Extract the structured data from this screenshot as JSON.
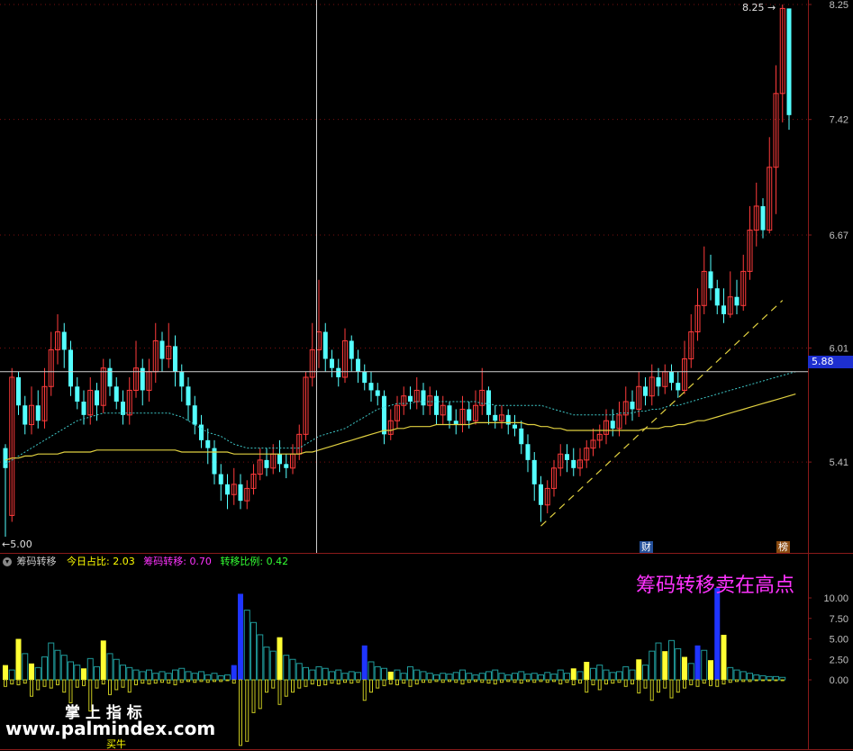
{
  "colors": {
    "up": "#ff3b3b",
    "down": "#54ffff",
    "ma_short": "#3ec8c8",
    "ma_long": "#e0d040",
    "grid": "#7a1010",
    "axis_text": "#c0c0c0",
    "today_ratio": "#ffff00",
    "chip_transfer": "#ff33ff",
    "transfer_ratio": "#33ff33",
    "bar_teal": "#1f9a9a",
    "bar_yellow": "#ffff33",
    "bar_blue": "#1f35ff",
    "neg_bar": "#c8c820",
    "annotation": "#ff33ff"
  },
  "price_panel": {
    "y_ticks": [
      "8.25",
      "7.42",
      "6.67",
      "6.01",
      "5.41"
    ],
    "y_tick_values": [
      8.25,
      7.42,
      6.67,
      6.01,
      5.41
    ],
    "current_price_label": "5.88",
    "current_price_value": 5.88,
    "high_label": "8.25",
    "high_value": 8.25,
    "low_label": "5.00",
    "low_value": 5.0,
    "badges": [
      "财",
      "榜"
    ]
  },
  "indicator_panel": {
    "name": "筹码转移",
    "today_ratio_label": "今日占比:",
    "today_ratio_value": "2.03",
    "chip_transfer_label": "筹码转移:",
    "chip_transfer_value": "0.70",
    "transfer_ratio_label": "转移比例:",
    "transfer_ratio_value": "0.42",
    "y_ticks": [
      "10.00",
      "7.50",
      "5.00",
      "2.50",
      "0.00"
    ],
    "y_tick_values": [
      10.0,
      7.5,
      5.0,
      2.5,
      0.0
    ],
    "annotation": "筹码转移卖在高点",
    "watermark_title": "掌 上 指 标",
    "watermark_url": "www.palmindex.com",
    "bottom_label": "买牛"
  },
  "chart_data": {
    "type": "candlestick",
    "y_scale": "log",
    "candles": [
      [
        5.48,
        5.38,
        5.5,
        5.05
      ],
      [
        5.15,
        5.85,
        5.9,
        5.12
      ],
      [
        5.85,
        5.7,
        5.88,
        5.65
      ],
      [
        5.7,
        5.6,
        5.75,
        5.55
      ],
      [
        5.6,
        5.7,
        5.8,
        5.55
      ],
      [
        5.7,
        5.62,
        5.78,
        5.58
      ],
      [
        5.62,
        5.8,
        5.9,
        5.58
      ],
      [
        5.8,
        6.0,
        6.1,
        5.75
      ],
      [
        6.0,
        6.1,
        6.2,
        5.92
      ],
      [
        6.1,
        6.0,
        6.15,
        5.9
      ],
      [
        6.0,
        5.8,
        6.05,
        5.75
      ],
      [
        5.8,
        5.72,
        5.85,
        5.68
      ],
      [
        5.72,
        5.65,
        5.78,
        5.6
      ],
      [
        5.65,
        5.78,
        5.85,
        5.6
      ],
      [
        5.78,
        5.7,
        5.82,
        5.62
      ],
      [
        5.7,
        5.9,
        5.95,
        5.66
      ],
      [
        5.9,
        5.8,
        5.95,
        5.75
      ],
      [
        5.8,
        5.72,
        5.85,
        5.68
      ],
      [
        5.72,
        5.65,
        5.78,
        5.6
      ],
      [
        5.65,
        5.78,
        5.85,
        5.6
      ],
      [
        5.78,
        5.9,
        6.05,
        5.74
      ],
      [
        5.9,
        5.78,
        5.95,
        5.7
      ],
      [
        5.78,
        5.88,
        5.95,
        5.72
      ],
      [
        5.88,
        6.05,
        6.15,
        5.82
      ],
      [
        6.05,
        5.95,
        6.1,
        5.88
      ],
      [
        5.95,
        6.02,
        6.15,
        5.9
      ],
      [
        6.02,
        5.88,
        6.08,
        5.8
      ],
      [
        5.88,
        5.8,
        5.92,
        5.72
      ],
      [
        5.8,
        5.7,
        5.85,
        5.62
      ],
      [
        5.7,
        5.6,
        5.75,
        5.55
      ],
      [
        5.6,
        5.52,
        5.65,
        5.48
      ],
      [
        5.52,
        5.48,
        5.58,
        5.4
      ],
      [
        5.48,
        5.35,
        5.52,
        5.3
      ],
      [
        5.35,
        5.3,
        5.4,
        5.22
      ],
      [
        5.3,
        5.25,
        5.35,
        5.18
      ],
      [
        5.25,
        5.3,
        5.38,
        5.2
      ],
      [
        5.3,
        5.22,
        5.35,
        5.18
      ],
      [
        5.22,
        5.28,
        5.32,
        5.18
      ],
      [
        5.28,
        5.35,
        5.4,
        5.25
      ],
      [
        5.35,
        5.42,
        5.48,
        5.32
      ],
      [
        5.42,
        5.38,
        5.48,
        5.34
      ],
      [
        5.38,
        5.45,
        5.5,
        5.35
      ],
      [
        5.45,
        5.4,
        5.52,
        5.36
      ],
      [
        5.4,
        5.38,
        5.45,
        5.33
      ],
      [
        5.38,
        5.45,
        5.5,
        5.35
      ],
      [
        5.45,
        5.55,
        5.6,
        5.42
      ],
      [
        5.55,
        5.85,
        5.88,
        5.52
      ],
      [
        5.85,
        6.0,
        6.15,
        5.8
      ],
      [
        6.0,
        6.1,
        6.4,
        5.9
      ],
      [
        6.1,
        5.95,
        6.15,
        5.88
      ],
      [
        5.95,
        5.9,
        6.0,
        5.85
      ],
      [
        5.9,
        5.85,
        5.95,
        5.8
      ],
      [
        5.85,
        6.05,
        6.12,
        5.82
      ],
      [
        6.05,
        5.95,
        6.08,
        5.88
      ],
      [
        5.95,
        5.88,
        6.0,
        5.82
      ],
      [
        5.88,
        5.82,
        5.92,
        5.78
      ],
      [
        5.82,
        5.78,
        5.88,
        5.72
      ],
      [
        5.78,
        5.75,
        5.82,
        5.7
      ],
      [
        5.75,
        5.55,
        5.78,
        5.5
      ],
      [
        5.55,
        5.62,
        5.68,
        5.52
      ],
      [
        5.62,
        5.7,
        5.75,
        5.58
      ],
      [
        5.7,
        5.75,
        5.8,
        5.65
      ],
      [
        5.75,
        5.72,
        5.8,
        5.68
      ],
      [
        5.72,
        5.78,
        5.85,
        5.68
      ],
      [
        5.78,
        5.7,
        5.82,
        5.65
      ],
      [
        5.7,
        5.75,
        5.8,
        5.65
      ],
      [
        5.75,
        5.65,
        5.78,
        5.6
      ],
      [
        5.65,
        5.7,
        5.75,
        5.6
      ],
      [
        5.7,
        5.62,
        5.72,
        5.58
      ],
      [
        5.62,
        5.6,
        5.68,
        5.55
      ],
      [
        5.6,
        5.68,
        5.75,
        5.56
      ],
      [
        5.68,
        5.62,
        5.72,
        5.58
      ],
      [
        5.62,
        5.7,
        5.78,
        5.6
      ],
      [
        5.7,
        5.78,
        5.9,
        5.65
      ],
      [
        5.78,
        5.65,
        5.8,
        5.6
      ],
      [
        5.65,
        5.62,
        5.7,
        5.58
      ],
      [
        5.62,
        5.65,
        5.7,
        5.58
      ],
      [
        5.65,
        5.6,
        5.68,
        5.55
      ],
      [
        5.6,
        5.58,
        5.65,
        5.54
      ],
      [
        5.58,
        5.5,
        5.62,
        5.45
      ],
      [
        5.5,
        5.42,
        5.55,
        5.36
      ],
      [
        5.42,
        5.3,
        5.46,
        5.22
      ],
      [
        5.3,
        5.2,
        5.34,
        5.12
      ],
      [
        5.2,
        5.28,
        5.32,
        5.16
      ],
      [
        5.28,
        5.38,
        5.42,
        5.24
      ],
      [
        5.38,
        5.45,
        5.5,
        5.34
      ],
      [
        5.45,
        5.42,
        5.5,
        5.36
      ],
      [
        5.42,
        5.38,
        5.48,
        5.34
      ],
      [
        5.38,
        5.42,
        5.48,
        5.34
      ],
      [
        5.42,
        5.48,
        5.52,
        5.38
      ],
      [
        5.48,
        5.52,
        5.58,
        5.44
      ],
      [
        5.52,
        5.55,
        5.6,
        5.48
      ],
      [
        5.55,
        5.62,
        5.68,
        5.5
      ],
      [
        5.62,
        5.58,
        5.68,
        5.54
      ],
      [
        5.58,
        5.65,
        5.72,
        5.54
      ],
      [
        5.65,
        5.72,
        5.8,
        5.6
      ],
      [
        5.72,
        5.68,
        5.78,
        5.62
      ],
      [
        5.68,
        5.8,
        5.88,
        5.64
      ],
      [
        5.8,
        5.75,
        5.85,
        5.7
      ],
      [
        5.75,
        5.85,
        5.92,
        5.7
      ],
      [
        5.85,
        5.8,
        5.9,
        5.75
      ],
      [
        5.8,
        5.88,
        5.92,
        5.76
      ],
      [
        5.88,
        5.82,
        5.92,
        5.78
      ],
      [
        5.82,
        5.78,
        5.88,
        5.74
      ],
      [
        5.78,
        5.95,
        6.05,
        5.76
      ],
      [
        5.95,
        6.1,
        6.2,
        5.9
      ],
      [
        6.1,
        6.25,
        6.35,
        6.05
      ],
      [
        6.25,
        6.45,
        6.6,
        6.2
      ],
      [
        6.45,
        6.35,
        6.55,
        6.28
      ],
      [
        6.35,
        6.25,
        6.4,
        6.2
      ],
      [
        6.25,
        6.2,
        6.35,
        6.15
      ],
      [
        6.2,
        6.3,
        6.45,
        6.18
      ],
      [
        6.3,
        6.25,
        6.4,
        6.2
      ],
      [
        6.25,
        6.45,
        6.55,
        6.22
      ],
      [
        6.45,
        6.7,
        6.85,
        6.4
      ],
      [
        6.7,
        6.85,
        7.0,
        6.6
      ],
      [
        6.85,
        6.7,
        6.9,
        6.65
      ],
      [
        6.7,
        7.1,
        7.3,
        6.68
      ],
      [
        7.1,
        7.6,
        7.8,
        6.8
      ],
      [
        7.6,
        8.22,
        8.25,
        7.4
      ],
      [
        8.22,
        7.45,
        8.0,
        7.35
      ]
    ],
    "ma_short": [
      5.4,
      5.42,
      5.44,
      5.46,
      5.48,
      5.5,
      5.52,
      5.54,
      5.56,
      5.58,
      5.6,
      5.62,
      5.63,
      5.64,
      5.65,
      5.66,
      5.66,
      5.66,
      5.66,
      5.66,
      5.66,
      5.66,
      5.66,
      5.66,
      5.66,
      5.66,
      5.65,
      5.64,
      5.62,
      5.6,
      5.58,
      5.56,
      5.55,
      5.54,
      5.52,
      5.5,
      5.49,
      5.48,
      5.48,
      5.48,
      5.48,
      5.48,
      5.48,
      5.48,
      5.48,
      5.48,
      5.5,
      5.52,
      5.54,
      5.55,
      5.56,
      5.57,
      5.58,
      5.6,
      5.62,
      5.64,
      5.66,
      5.68,
      5.69,
      5.7,
      5.71,
      5.71,
      5.71,
      5.72,
      5.72,
      5.72,
      5.72,
      5.72,
      5.72,
      5.72,
      5.72,
      5.72,
      5.72,
      5.71,
      5.71,
      5.7,
      5.7,
      5.7,
      5.7,
      5.7,
      5.7,
      5.7,
      5.7,
      5.69,
      5.68,
      5.67,
      5.66,
      5.65,
      5.65,
      5.65,
      5.65,
      5.65,
      5.65,
      5.65,
      5.66,
      5.66,
      5.66,
      5.67,
      5.67,
      5.68,
      5.68,
      5.69,
      5.7,
      5.7,
      5.71,
      5.72,
      5.73,
      5.74,
      5.75,
      5.76,
      5.77,
      5.78,
      5.79,
      5.8,
      5.81,
      5.82,
      5.83,
      5.84,
      5.85,
      5.86,
      5.87,
      5.88
    ],
    "ma_long": [
      5.42,
      5.43,
      5.43,
      5.44,
      5.44,
      5.45,
      5.45,
      5.45,
      5.45,
      5.46,
      5.46,
      5.46,
      5.46,
      5.46,
      5.47,
      5.47,
      5.47,
      5.47,
      5.47,
      5.47,
      5.47,
      5.47,
      5.47,
      5.47,
      5.47,
      5.47,
      5.47,
      5.46,
      5.46,
      5.46,
      5.46,
      5.46,
      5.46,
      5.46,
      5.46,
      5.45,
      5.45,
      5.45,
      5.45,
      5.45,
      5.45,
      5.45,
      5.45,
      5.45,
      5.45,
      5.45,
      5.46,
      5.46,
      5.47,
      5.48,
      5.49,
      5.5,
      5.51,
      5.52,
      5.53,
      5.54,
      5.55,
      5.56,
      5.57,
      5.57,
      5.58,
      5.58,
      5.59,
      5.59,
      5.59,
      5.59,
      5.6,
      5.6,
      5.6,
      5.6,
      5.6,
      5.6,
      5.61,
      5.61,
      5.61,
      5.61,
      5.61,
      5.61,
      5.61,
      5.61,
      5.6,
      5.6,
      5.59,
      5.59,
      5.58,
      5.58,
      5.57,
      5.57,
      5.57,
      5.57,
      5.57,
      5.57,
      5.57,
      5.57,
      5.57,
      5.57,
      5.57,
      5.57,
      5.58,
      5.58,
      5.58,
      5.59,
      5.59,
      5.6,
      5.6,
      5.61,
      5.62,
      5.62,
      5.63,
      5.64,
      5.65,
      5.66,
      5.67,
      5.68,
      5.69,
      5.7,
      5.71,
      5.72,
      5.73,
      5.74,
      5.75,
      5.76
    ],
    "support_line": {
      "start_index": 82,
      "start_value": 5.1,
      "end_index": 119,
      "end_value": 6.28
    },
    "indicator_bars": [
      [
        1.8,
        1,
        -0.8
      ],
      [
        1.2,
        0,
        -0.5
      ],
      [
        5.0,
        1,
        -0.6
      ],
      [
        3.2,
        0,
        -0.4
      ],
      [
        2.0,
        1,
        -2.0
      ],
      [
        1.5,
        0,
        -1.2
      ],
      [
        2.8,
        0,
        -0.8
      ],
      [
        4.5,
        0,
        -1.0
      ],
      [
        3.6,
        0,
        -0.6
      ],
      [
        3.0,
        0,
        -1.5
      ],
      [
        2.2,
        0,
        -2.8
      ],
      [
        1.8,
        0,
        -0.9
      ],
      [
        1.4,
        1,
        -0.7
      ],
      [
        2.6,
        0,
        -3.8
      ],
      [
        1.6,
        0,
        -1.0
      ],
      [
        4.8,
        1,
        -0.5
      ],
      [
        3.2,
        0,
        -1.8
      ],
      [
        2.5,
        0,
        -1.2
      ],
      [
        1.8,
        0,
        -0.9
      ],
      [
        1.5,
        0,
        -1.5
      ],
      [
        1.2,
        0,
        -0.6
      ],
      [
        1.0,
        0,
        -0.4
      ],
      [
        1.2,
        0,
        -0.5
      ],
      [
        0.8,
        0,
        -0.4
      ],
      [
        1.0,
        0,
        -0.3
      ],
      [
        0.8,
        0,
        -0.4
      ],
      [
        1.2,
        0,
        -0.6
      ],
      [
        1.4,
        0,
        -0.3
      ],
      [
        1.0,
        0,
        -0.2
      ],
      [
        0.8,
        0,
        -0.3
      ],
      [
        1.0,
        0,
        -0.2
      ],
      [
        0.6,
        0,
        -0.3
      ],
      [
        0.8,
        0,
        -0.2
      ],
      [
        0.5,
        0,
        -0.2
      ],
      [
        0.6,
        0,
        -0.1
      ],
      [
        1.8,
        2,
        -0.4
      ],
      [
        10.5,
        2,
        -8.0
      ],
      [
        8.5,
        0,
        -7.5
      ],
      [
        7.0,
        0,
        -4.0
      ],
      [
        5.5,
        0,
        -3.5
      ],
      [
        4.0,
        0,
        -1.5
      ],
      [
        3.5,
        0,
        -1.0
      ],
      [
        5.2,
        1,
        -3.0
      ],
      [
        3.0,
        0,
        -2.0
      ],
      [
        2.5,
        0,
        -1.5
      ],
      [
        2.0,
        0,
        -1.0
      ],
      [
        1.5,
        0,
        -0.8
      ],
      [
        1.2,
        0,
        -0.5
      ],
      [
        1.6,
        0,
        -0.7
      ],
      [
        1.4,
        0,
        -0.6
      ],
      [
        1.0,
        0,
        -0.4
      ],
      [
        1.2,
        0,
        -0.5
      ],
      [
        0.8,
        0,
        -0.3
      ],
      [
        1.0,
        0,
        -0.4
      ],
      [
        0.9,
        0,
        -0.3
      ],
      [
        4.2,
        2,
        -2.5
      ],
      [
        2.2,
        0,
        -1.5
      ],
      [
        1.6,
        0,
        -1.0
      ],
      [
        1.4,
        0,
        -0.7
      ],
      [
        1.0,
        1,
        -0.5
      ],
      [
        1.2,
        0,
        -0.6
      ],
      [
        0.8,
        0,
        -0.4
      ],
      [
        1.6,
        0,
        -0.8
      ],
      [
        1.2,
        0,
        -0.5
      ],
      [
        1.0,
        0,
        -0.3
      ],
      [
        0.8,
        0,
        -0.3
      ],
      [
        0.6,
        0,
        -0.2
      ],
      [
        0.8,
        0,
        -0.3
      ],
      [
        0.7,
        0,
        -0.2
      ],
      [
        0.9,
        0,
        -0.3
      ],
      [
        1.2,
        0,
        -0.5
      ],
      [
        0.8,
        0,
        -0.3
      ],
      [
        0.6,
        0,
        -0.2
      ],
      [
        0.8,
        0,
        -0.3
      ],
      [
        1.0,
        0,
        -0.4
      ],
      [
        1.2,
        0,
        -0.5
      ],
      [
        0.8,
        0,
        -0.3
      ],
      [
        0.6,
        0,
        -0.2
      ],
      [
        0.8,
        0,
        -0.3
      ],
      [
        1.0,
        0,
        -0.4
      ],
      [
        0.7,
        0,
        -0.2
      ],
      [
        0.8,
        0,
        -0.3
      ],
      [
        0.6,
        0,
        -0.2
      ],
      [
        0.9,
        0,
        -0.3
      ],
      [
        0.7,
        0,
        -0.2
      ],
      [
        1.2,
        0,
        -0.5
      ],
      [
        0.8,
        0,
        -0.3
      ],
      [
        1.4,
        1,
        -0.6
      ],
      [
        1.0,
        0,
        -0.4
      ],
      [
        2.2,
        1,
        -1.5
      ],
      [
        1.4,
        0,
        -0.6
      ],
      [
        1.8,
        0,
        -1.2
      ],
      [
        1.2,
        0,
        -0.5
      ],
      [
        0.9,
        0,
        -0.4
      ],
      [
        1.0,
        0,
        -0.3
      ],
      [
        1.6,
        0,
        -0.8
      ],
      [
        1.2,
        0,
        -0.5
      ],
      [
        2.5,
        1,
        -1.6
      ],
      [
        1.8,
        0,
        -1.0
      ],
      [
        3.5,
        0,
        -2.5
      ],
      [
        4.5,
        0,
        -1.5
      ],
      [
        3.5,
        1,
        -1.0
      ],
      [
        4.8,
        0,
        -2.2
      ],
      [
        3.8,
        0,
        -1.5
      ],
      [
        2.8,
        1,
        -1.0
      ],
      [
        2.0,
        0,
        -0.6
      ],
      [
        4.2,
        2,
        -0.8
      ],
      [
        3.6,
        0,
        -0.4
      ],
      [
        2.4,
        1,
        -0.7
      ],
      [
        11.2,
        2,
        -0.8
      ],
      [
        5.5,
        1,
        -0.5
      ],
      [
        1.5,
        0,
        -0.3
      ],
      [
        1.2,
        0,
        -0.2
      ],
      [
        1.0,
        0,
        -0.2
      ],
      [
        0.8,
        0,
        -0.2
      ],
      [
        0.6,
        0,
        -0.1
      ],
      [
        0.5,
        0,
        -0.1
      ],
      [
        0.4,
        0,
        -0.1
      ],
      [
        0.4,
        0,
        -0.1
      ],
      [
        0.3,
        0,
        -0.1
      ]
    ]
  }
}
